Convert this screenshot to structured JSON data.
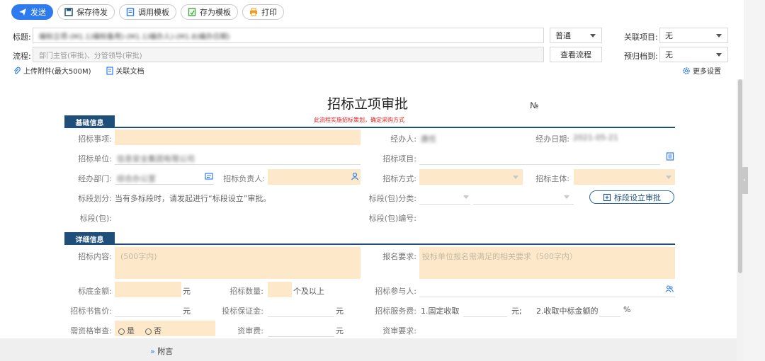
{
  "toolbar": {
    "send": "发送",
    "save_pending": "保存待发",
    "use_template": "调用模板",
    "save_template": "存为模板",
    "print": "打印"
  },
  "header": {
    "title_label": "标题:",
    "title_value": "编标立项-(M1.1)编标备用)-(M1.1)编办人)-(M1.8)编办日期)",
    "priority_value": "普通",
    "related_project_label": "关联项目:",
    "related_project_value": "无",
    "flow_label": "流程:",
    "flow_value": "部门主管(审批)、分管领导(审批)",
    "view_flow": "查看流程",
    "archive_label": "预归档到:",
    "archive_value": "无",
    "upload": "上传附件(最大500M)",
    "related_doc": "关联文档",
    "more_settings": "更多设置"
  },
  "form": {
    "title": "招标立项审批",
    "number_label": "№",
    "note": "此流程实施招标策划，确定采购方式",
    "basic": {
      "section": "基础信息",
      "bid_item": "招标事项:",
      "handler": "经办人:",
      "handler_value": "唐任",
      "handle_date": "经办日期:",
      "handle_date_value": "2021-05-21",
      "bid_unit": "招标单位:",
      "bid_unit_value": "信息安全集团有限公司",
      "bid_project": "招标项目:",
      "dept": "经办部门:",
      "dept_value": "综合办公室",
      "bid_leader": "招标负责人:",
      "bid_method": "招标方式:",
      "bid_subject": "招标主体:",
      "section_div": "标段划分:",
      "section_div_value": "当有多标段时，请发起进行“标段设立”审批。",
      "section_class": "标段(包)分类:",
      "section_approve": "标段设立审批",
      "section_pkg": "标段(包):",
      "section_code": "标段(包)编号:"
    },
    "detail": {
      "section": "详细信息",
      "content": "招标内容:",
      "content_ph": "(500字内)",
      "signup": "报名要求:",
      "signup_ph": "投标单位报名需满足的相关要求（500字内）",
      "base_amount": "标底金额:",
      "yuan": "元",
      "bid_count": "招标数量:",
      "count_unit": "个及以上",
      "participants": "招标参与人:",
      "doc_price": "招标书售价:",
      "deposit": "投标保证金:",
      "service_fee": "招标服务费:",
      "fixed_fee": "1.固定收取",
      "yuan_sep": "元;",
      "pct_fee": "2.收取中标金额的",
      "pct": "%",
      "qual_check": "需资格审查:",
      "yes": "是",
      "no": "否",
      "review_fee": "资审费:",
      "review_req": "资审要求:"
    }
  },
  "footer": {
    "attach": "附言"
  },
  "colors": {
    "primary": "#2e7bf0",
    "section": "#1e4f7a",
    "required_bg": "#fde9c9",
    "note": "#e02020"
  }
}
